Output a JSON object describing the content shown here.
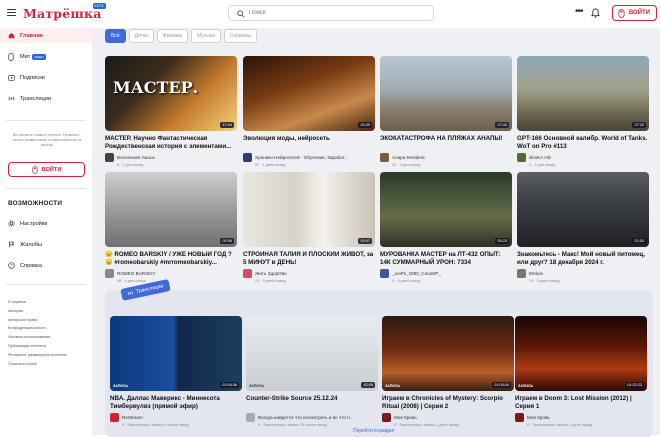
{
  "header": {
    "logo_text": "Матрёшка",
    "logo_badge": "БЕТА",
    "search_placeholder": "Поиск",
    "login_label": "ВОЙТИ"
  },
  "sidebar": {
    "items": [
      {
        "label": "Главная",
        "active": true
      },
      {
        "label": "Мит",
        "badge": "скоро"
      },
      {
        "label": "Подписки"
      },
      {
        "label": "Трансляции"
      }
    ],
    "note": "Вы сможете ставить отметки \"Нравится\", писать комментарии и подписываться на каналы",
    "login_label": "ВОЙТИ",
    "section_heading": "ВОЗМОЖНОСТИ",
    "features": [
      {
        "label": "Настройки"
      },
      {
        "label": "Жалобы"
      },
      {
        "label": "Справка"
      }
    ],
    "footer_links": [
      "О сервисе",
      "Авторам",
      "Авторское право",
      "Конфиденциальность",
      "Условия использования",
      "Публикация контента",
      "Регламент размещения контента",
      "Политика cookie"
    ]
  },
  "filters": [
    "Всё",
    "Детки",
    "Фильмы",
    "Музыка",
    "Сериалы"
  ],
  "videos": [
    {
      "title": "МАСТЕР. Научно Фантастическая Рождественская история с элементами...",
      "channel": "Вселенная Ужаса",
      "meta": "8 · 2 дня назад",
      "duration": "17:44"
    },
    {
      "title": "Эволюция моды, нейросеть",
      "channel": "Хроники Нейросетей - Обучение, Заработ...",
      "meta": "87 · 1 день назад",
      "duration": "00:39"
    },
    {
      "title": "ЭКОКАТАСТРОФА НА ПЛЯЖАХ АНАПЫ!",
      "channel": "Anapa Resident",
      "meta": "32 · 4 дня назад",
      "duration": "07:42"
    },
    {
      "title": "GPT-166 Основной калибр. World of Tanks. WoT on Pro #113",
      "channel": "slimKA HD",
      "meta": "6 · 2 дня назад",
      "duration": "27:20"
    },
    {
      "title": "😠 ROMEO BARSKIY / УЖЕ НОВЫЙ ГОД ? 😠 #romeobarskiy #mrromeobarskiy...",
      "channel": "ROMEO BARSKIY",
      "meta": "48 · 4 дня назад",
      "duration": "00:56"
    },
    {
      "title": "СТРОЙНАЯ ТАЛИЯ И ПЛОСКИЙ ЖИВОТ, за 5 МИНУТ в ДЕНЬ!",
      "channel": "Жить ЗдорОво",
      "meta": "23 · 5 дней назад",
      "duration": "00:07"
    },
    {
      "title": "МУРОВАНКА МАСТЕР на ЛТ-432 ОПЫТ: 14К СУММАРНЫЙ УРОН: 7334",
      "channel": "_uniFb_1980_C4unEP_",
      "meta": "9 · 5 дней назад",
      "duration": "05:23"
    },
    {
      "title": "Знакомьтесь - Макс! Мой новый питомец, или друг? 18 декабря 2024 г.",
      "channel": "Eteluin",
      "meta": "14 · 5 дней назад",
      "duration": "02:53"
    }
  ],
  "live_section": {
    "label": "Трансляции",
    "more_link": "Перейти в раздел",
    "items": [
      {
        "title": "NBA. Даллас Маверикс - Миннесота Тимбервулвз (прямой эфир)",
        "channel": "ReStream",
        "meta": "6 · Закончилась запись 8 часов назад",
        "duration": "02:06:36",
        "tag": "ЗАПИСЬ"
      },
      {
        "title": "Counter-Strike Source 25.12.24",
        "channel": "Всегда найдется что посмотреть и во что п...",
        "meta": "6 · Закончилась запись 13 часов назад",
        "duration": "42:05",
        "tag": "ЗАПИСЬ"
      },
      {
        "title": "Играем в Chronicles of Mystery: Scorpio Ritual (2008) | Серия 2",
        "channel": "Моя Кровь",
        "meta": "5 · Закончилась запись 1 день назад",
        "duration": "01:05:04",
        "tag": "ЗАПИСЬ"
      },
      {
        "title": "Играем в Doom 3: Lost Mission (2012) | Серия 1",
        "channel": "Моя Кровь",
        "meta": "6 · Закончилась запись 1 день назад",
        "duration": "01:22:23",
        "tag": "ЗАПИСЬ"
      }
    ]
  }
}
